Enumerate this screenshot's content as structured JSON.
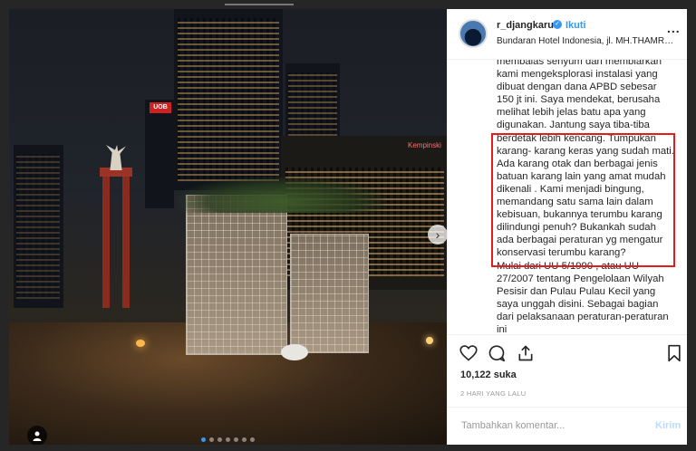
{
  "post": {
    "username": "r_djangkaru",
    "follow_label": "Ikuti",
    "location": "Bundaran Hotel Indonesia, jl. MH.THAMRIN, J...",
    "more_label": "...",
    "caption": "membalas senyum dan membiarkan kami mengeksplorasi instalasi yang dibuat dengan dana APBD sebesar 150 jt ini. Saya mendekat, berusaha melihat lebih jelas batu apa yang digunakan. Jantung saya tiba-tiba berdetak lebih kencang. Tumpukan karang- karang keras yang sudah mati. Ada karang otak dan berbagai jenis batuan karang lain yang amat mudah dikenali . Kami menjadi bingung, memandang satu sama lain dalam kebisuan, bukannya terumbu karang dilindungi penuh? Bukankah sudah ada berbagai peraturan yg mengatur konservasi terumbu karang?\nMulai dari UU 5/1990 , atau UU 27/2007 tentang Pengelolaan Wilyah Pesisir dan Pulau Pulau Kecil yang saya unggah disini. Sebagai bagian dari pelaksanaan peraturan-peraturan ini",
    "likes": "10,122 suka",
    "timestamp": "2 HARI YANG LALU",
    "comment_placeholder": "Tambahkan komentar...",
    "post_label": "Kirim"
  },
  "photo": {
    "signs": {
      "uob": "UOB",
      "hotel": "Kempinski"
    }
  },
  "icons": {
    "verified": "verified-badge-icon",
    "like": "heart-icon",
    "comment": "comment-icon",
    "share": "share-icon",
    "save": "bookmark-icon",
    "next": "chevron-right-icon",
    "user_tag": "user-tag-icon"
  },
  "colors": {
    "accent": "#3897f0",
    "highlight_box": "#e01e1e"
  }
}
